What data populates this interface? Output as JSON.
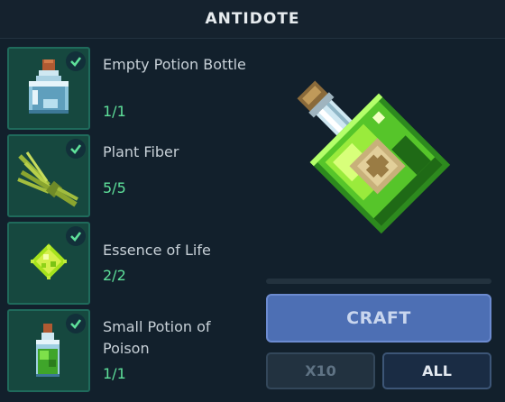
{
  "header": {
    "title": "ANTIDOTE"
  },
  "ingredients": [
    {
      "name": "Empty Potion Bottle",
      "count": "1/1",
      "icon": "empty-potion-bottle-icon",
      "complete": true
    },
    {
      "name": "Plant Fiber",
      "count": "5/5",
      "icon": "plant-fiber-icon",
      "complete": true
    },
    {
      "name": "Essence of Life",
      "count": "2/2",
      "icon": "essence-of-life-icon",
      "complete": true
    },
    {
      "name": "Small Potion of Poison",
      "count": "1/1",
      "icon": "small-potion-of-poison-icon",
      "complete": true
    }
  ],
  "result": {
    "icon": "antidote-potion-icon"
  },
  "craft_progress": 0,
  "actions": {
    "craft_label": "CRAFT",
    "x10_label": "X10",
    "all_label": "ALL"
  },
  "colors": {
    "background": "#12202c",
    "slot": "#16483f",
    "count_ok": "#5ee09a",
    "craft_button": "#4d6fb4"
  }
}
